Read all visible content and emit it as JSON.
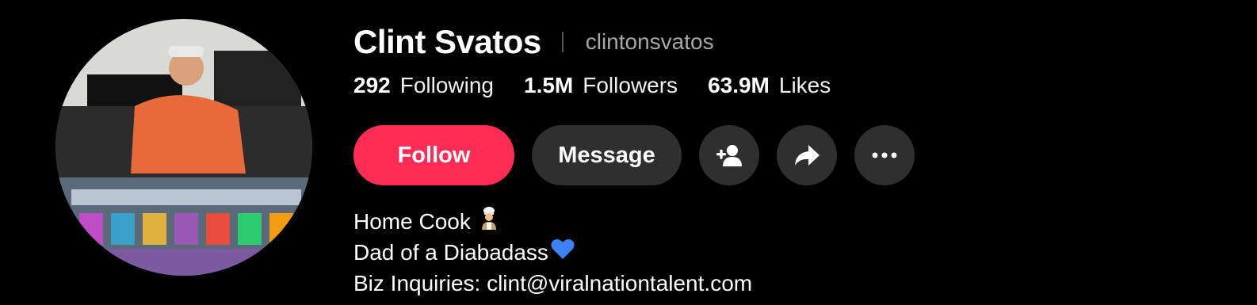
{
  "profile": {
    "display_name": "Clint Svatos",
    "username": "clintonsvatos",
    "avatar_alt": "profile-photo"
  },
  "stats": [
    {
      "value": "292",
      "label": "Following"
    },
    {
      "value": "1.5M",
      "label": "Followers"
    },
    {
      "value": "63.9M",
      "label": "Likes"
    }
  ],
  "actions": {
    "follow_label": "Follow",
    "message_label": "Message",
    "icons": [
      "add-friend-icon",
      "share-icon",
      "more-icon"
    ]
  },
  "bio": {
    "line1": "Home Cook",
    "line2": "Dad of a Diabadass",
    "line3": "Biz Inquiries: clint@viralnationtalent.com"
  },
  "colors": {
    "background": "#000000",
    "accent": "#fe2c55",
    "secondary_button": "#2f2f2f",
    "muted_text": "#a7a7a7",
    "heart": "#3b82f6"
  }
}
